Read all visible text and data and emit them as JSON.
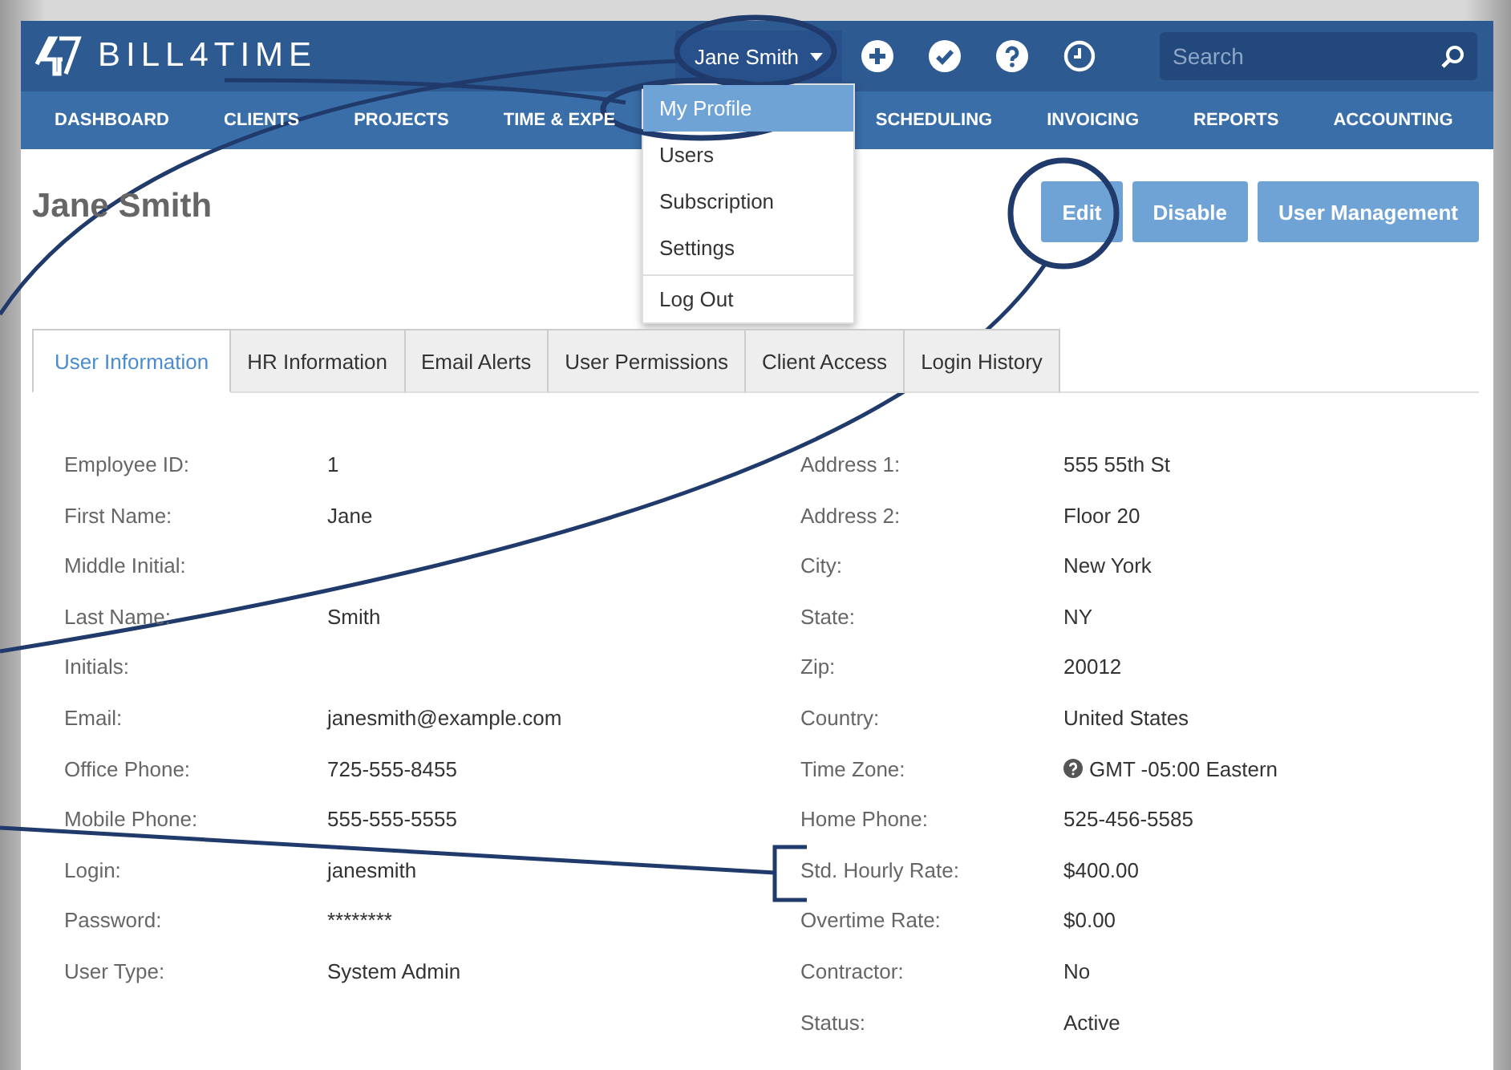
{
  "header": {
    "logo_text": "BILL4TIME",
    "user_menu": {
      "label": "Jane Smith"
    },
    "search": {
      "placeholder": "Search"
    }
  },
  "nav": [
    {
      "label": "DASHBOARD"
    },
    {
      "label": "CLIENTS"
    },
    {
      "label": "PROJECTS"
    },
    {
      "label": "TIME & EXPE"
    },
    {
      "label": "SCHEDULING"
    },
    {
      "label": "INVOICING"
    },
    {
      "label": "REPORTS"
    },
    {
      "label": "ACCOUNTING"
    }
  ],
  "user_dropdown": [
    {
      "label": "My Profile",
      "selected": true
    },
    {
      "label": "Users",
      "selected": false
    },
    {
      "label": "Subscription",
      "selected": false
    },
    {
      "label": "Settings",
      "selected": false
    },
    {
      "label": "Log Out",
      "selected": false
    }
  ],
  "page_title": "Jane Smith",
  "buttons": [
    "Edit",
    "Disable",
    "User Management"
  ],
  "tabs": [
    {
      "label": "User Information",
      "selected": true
    },
    {
      "label": "HR Information",
      "selected": false
    },
    {
      "label": "Email Alerts",
      "selected": false
    },
    {
      "label": "User Permissions",
      "selected": false
    },
    {
      "label": "Client Access",
      "selected": false
    },
    {
      "label": "Login History",
      "selected": false
    }
  ],
  "left_fields": [
    {
      "label": "Employee ID:",
      "value": "1"
    },
    {
      "label": "First Name:",
      "value": "Jane"
    },
    {
      "label": "Middle Initial:"
    },
    {
      "label": "Last Name:",
      "value": "Smith"
    },
    {
      "label": "Initials:"
    },
    {
      "label": "Email:",
      "value": "janesmith@example.com"
    },
    {
      "label": "Office Phone:",
      "value": "725-555-8455"
    },
    {
      "label": "Mobile Phone:",
      "value": "555-555-5555"
    },
    {
      "label": "Login:",
      "value": "janesmith"
    },
    {
      "label": "Password:",
      "value": "********"
    },
    {
      "label": "User Type:",
      "value": "System Admin"
    }
  ],
  "right_fields": [
    {
      "label": "Address 1:",
      "value": "555 55th St"
    },
    {
      "label": "Address 2:",
      "value": "Floor 20"
    },
    {
      "label": "City:",
      "value": "New York"
    },
    {
      "label": "State:",
      "value": "NY"
    },
    {
      "label": "Zip:",
      "value": "20012"
    },
    {
      "label": "Country:",
      "value": "United States"
    },
    {
      "label": "Time Zone:",
      "value": "GMT -05:00 Eastern",
      "kind": "help"
    },
    {
      "label": "Home Phone:",
      "value": "525-456-5585"
    },
    {
      "label": "Std. Hourly Rate:",
      "value": "$400.00"
    },
    {
      "label": "Overtime Rate:",
      "value": "$0.00"
    },
    {
      "label": "Contractor:",
      "value": "No"
    },
    {
      "label": "Status:",
      "value": "Active"
    }
  ]
}
